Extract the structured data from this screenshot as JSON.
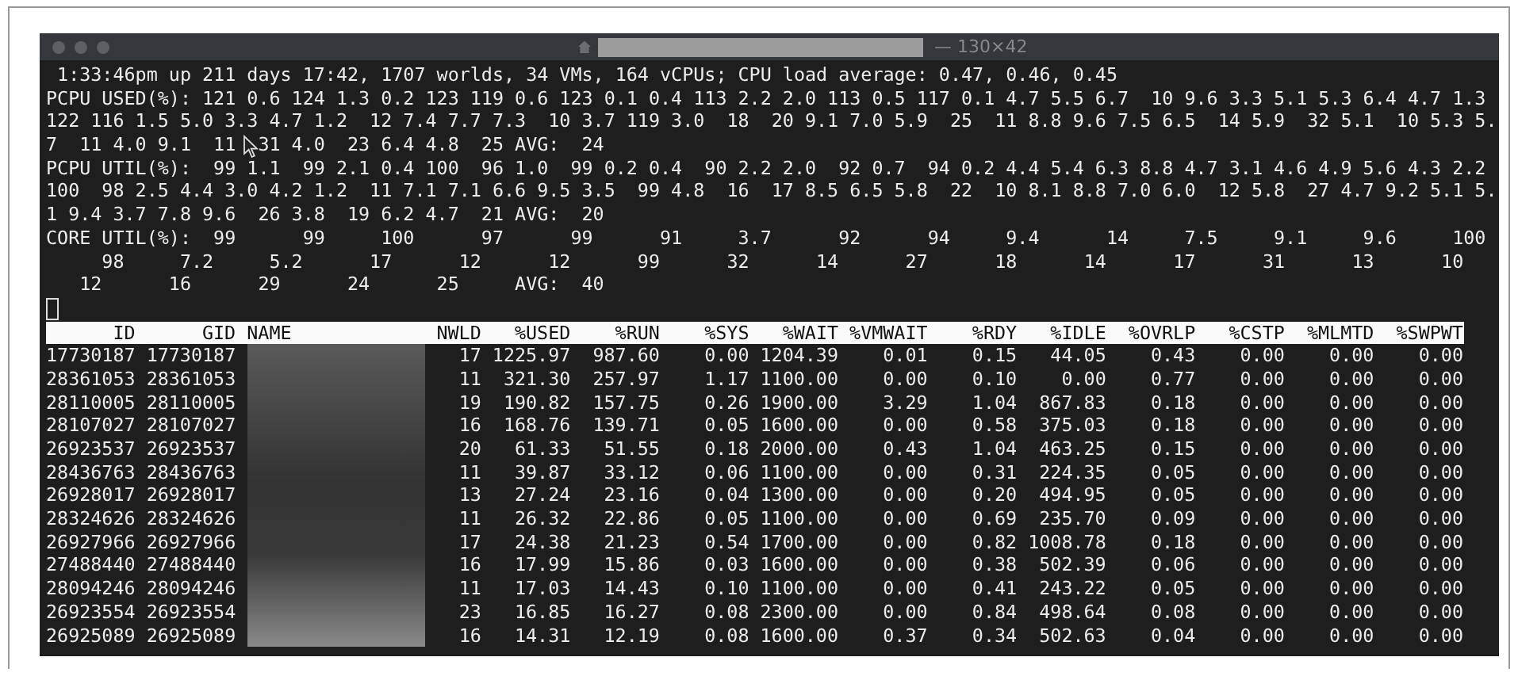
{
  "window": {
    "title": "— 130×42"
  },
  "summary_lines": [
    " 1:33:46pm up 211 days 17:42, 1707 worlds, 34 VMs, 164 vCPUs; CPU load average: 0.47, 0.46, 0.45",
    "PCPU USED(%): 121 0.6 124 1.3 0.2 123 119 0.6 123 0.1 0.4 113 2.2 2.0 113 0.5 117 0.1 4.7 5.5 6.7  10 9.6 3.3 5.1 5.3 6.4 4.7 1.3",
    "122 116 1.5 5.0 3.3 4.7 1.2  12 7.4 7.7 7.3  10 3.7 119 3.0  18  20 9.1 7.0 5.9  25  11 8.8 9.6 7.5 6.5  14 5.9  32 5.1  10 5.3 5.",
    "7  11 4.0 9.1  11  31 4.0  23 6.4 4.8  25 AVG:  24",
    "PCPU UTIL(%):  99 1.1  99 2.1 0.4 100  96 1.0  99 0.2 0.4  90 2.2 2.0  92 0.7  94 0.2 4.4 5.4 6.3 8.8 4.7 3.1 4.6 4.9 5.6 4.3 2.2",
    "100  98 2.5 4.4 3.0 4.2 1.2  11 7.1 7.1 6.6 9.5 3.5  99 4.8  16  17 8.5 6.5 5.8  22  10 8.1 8.8 7.0 6.0  12 5.8  27 4.7 9.2 5.1 5.",
    "1 9.4 3.7 7.8 9.6  26 3.8  19 6.2 4.7  21 AVG:  20",
    "CORE UTIL(%):  99      99     100      97      99      91     3.7      92      94     9.4      14     7.5     9.1     9.6     100",
    "     98     7.2     5.2      17      12      12      99      32      14      27      18      14      17      31      13      10",
    "   12      16      29      24      25     AVG:  40"
  ],
  "table": {
    "columns": [
      {
        "label": "ID",
        "kind": "number"
      },
      {
        "label": "GID",
        "kind": "number"
      },
      {
        "label": "NAME",
        "kind": "name"
      },
      {
        "label": "NWLD",
        "kind": "number"
      },
      {
        "label": "%USED",
        "kind": "number"
      },
      {
        "label": "%RUN",
        "kind": "number"
      },
      {
        "label": "%SYS",
        "kind": "number"
      },
      {
        "label": "%WAIT",
        "kind": "number"
      },
      {
        "label": "%VMWAIT",
        "kind": "number"
      },
      {
        "label": "%RDY",
        "kind": "number"
      },
      {
        "label": "%IDLE",
        "kind": "number"
      },
      {
        "label": "%OVRLP",
        "kind": "number"
      },
      {
        "label": "%CSTP",
        "kind": "number"
      },
      {
        "label": "%MLMTD",
        "kind": "number"
      },
      {
        "label": "%SWPWT",
        "kind": "number"
      }
    ],
    "rows": [
      {
        "cells": [
          "17730187",
          "17730187",
          "",
          "17",
          "1225.97",
          "987.60",
          "0.00",
          "1204.39",
          "0.01",
          "0.15",
          "44.05",
          "0.43",
          "0.00",
          "0.00",
          "0.00"
        ]
      },
      {
        "cells": [
          "28361053",
          "28361053",
          "",
          "11",
          "321.30",
          "257.97",
          "1.17",
          "1100.00",
          "0.00",
          "0.10",
          "0.00",
          "0.77",
          "0.00",
          "0.00",
          "0.00"
        ]
      },
      {
        "cells": [
          "28110005",
          "28110005",
          "",
          "19",
          "190.82",
          "157.75",
          "0.26",
          "1900.00",
          "3.29",
          "1.04",
          "867.83",
          "0.18",
          "0.00",
          "0.00",
          "0.00"
        ]
      },
      {
        "cells": [
          "28107027",
          "28107027",
          "",
          "16",
          "168.76",
          "139.71",
          "0.05",
          "1600.00",
          "0.00",
          "0.58",
          "375.03",
          "0.18",
          "0.00",
          "0.00",
          "0.00"
        ]
      },
      {
        "cells": [
          "26923537",
          "26923537",
          "",
          "20",
          "61.33",
          "51.55",
          "0.18",
          "2000.00",
          "0.43",
          "1.04",
          "463.25",
          "0.15",
          "0.00",
          "0.00",
          "0.00"
        ]
      },
      {
        "cells": [
          "28436763",
          "28436763",
          "",
          "11",
          "39.87",
          "33.12",
          "0.06",
          "1100.00",
          "0.00",
          "0.31",
          "224.35",
          "0.05",
          "0.00",
          "0.00",
          "0.00"
        ]
      },
      {
        "cells": [
          "26928017",
          "26928017",
          "",
          "13",
          "27.24",
          "23.16",
          "0.04",
          "1300.00",
          "0.00",
          "0.20",
          "494.95",
          "0.05",
          "0.00",
          "0.00",
          "0.00"
        ]
      },
      {
        "cells": [
          "28324626",
          "28324626",
          "",
          "11",
          "26.32",
          "22.86",
          "0.05",
          "1100.00",
          "0.00",
          "0.69",
          "235.70",
          "0.09",
          "0.00",
          "0.00",
          "0.00"
        ]
      },
      {
        "cells": [
          "26927966",
          "26927966",
          "",
          "17",
          "24.38",
          "21.23",
          "0.54",
          "1700.00",
          "0.00",
          "0.82",
          "1008.78",
          "0.18",
          "0.00",
          "0.00",
          "0.00"
        ]
      },
      {
        "cells": [
          "27488440",
          "27488440",
          "",
          "16",
          "17.99",
          "15.86",
          "0.03",
          "1600.00",
          "0.00",
          "0.38",
          "502.39",
          "0.06",
          "0.00",
          "0.00",
          "0.00"
        ]
      },
      {
        "cells": [
          "28094246",
          "28094246",
          "",
          "11",
          "17.03",
          "14.43",
          "0.10",
          "1100.00",
          "0.00",
          "0.41",
          "243.22",
          "0.05",
          "0.00",
          "0.00",
          "0.00"
        ]
      },
      {
        "cells": [
          "26923554",
          "26923554",
          "",
          "23",
          "16.85",
          "16.27",
          "0.08",
          "2300.00",
          "0.00",
          "0.84",
          "498.64",
          "0.08",
          "0.00",
          "0.00",
          "0.00"
        ]
      },
      {
        "cells": [
          "26925089",
          "26925089",
          "",
          "16",
          "14.31",
          "12.19",
          "0.08",
          "1600.00",
          "0.37",
          "0.34",
          "502.63",
          "0.04",
          "0.00",
          "0.00",
          "0.00"
        ]
      }
    ]
  }
}
